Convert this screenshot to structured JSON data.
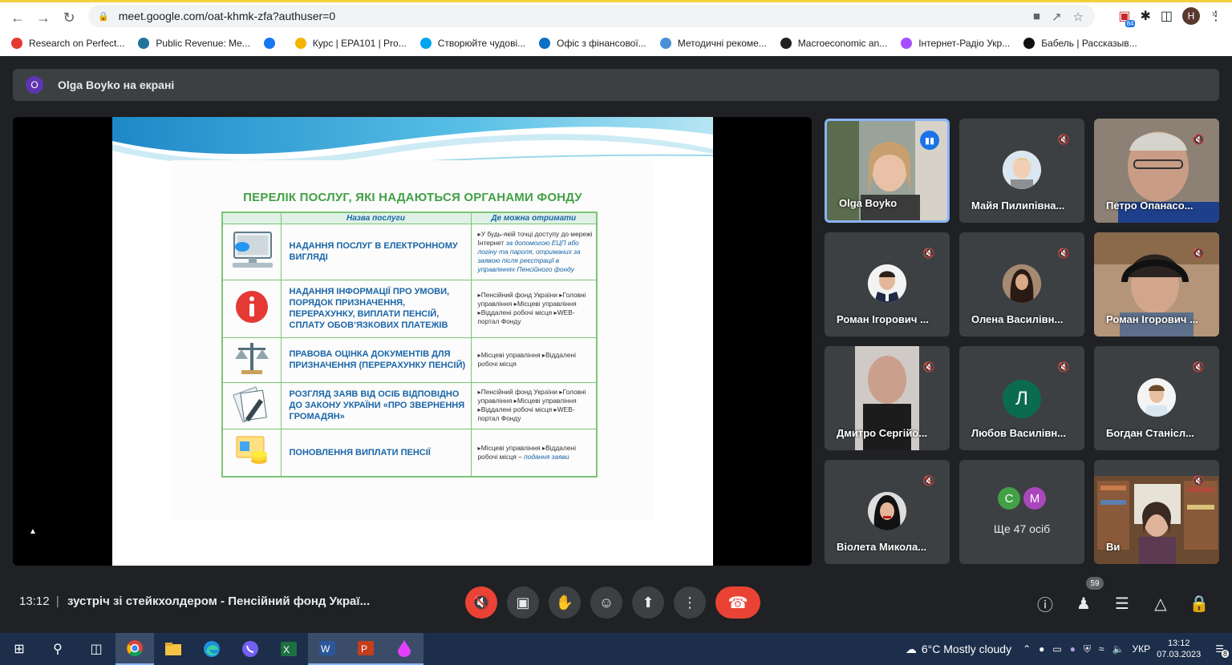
{
  "browser": {
    "url": "meet.google.com/oat-khmk-zfa?authuser=0",
    "profile_initial": "H",
    "ext_badge": "84",
    "bookmarks": [
      {
        "label": "Research on Perfect...",
        "color": "#e53935"
      },
      {
        "label": "Public Revenue: Me...",
        "color": "#21759b"
      },
      {
        "label": "",
        "color": "#1877f2"
      },
      {
        "label": "Курс | EPA101 | Pro...",
        "color": "#f4b400"
      },
      {
        "label": "Створюйте чудові...",
        "color": "#00a4ef"
      },
      {
        "label": "Офіс з фінансової...",
        "color": "#0b6fc4"
      },
      {
        "label": "Методичні рекоме...",
        "color": "#4a90d9"
      },
      {
        "label": "Macroeconomic an...",
        "color": "#222222"
      },
      {
        "label": "Інтернет-Радіо Укр...",
        "color": "#a64dff"
      },
      {
        "label": "Бабель | Рассказыв...",
        "color": "#111111"
      }
    ]
  },
  "meet": {
    "presenting_label": "Olga Boyko на екрані",
    "presenter_initial": "O",
    "slide": {
      "title": "ПЕРЕЛІК ПОСЛУГ, ЯКІ НАДАЮТЬСЯ ОРГАНАМИ ФОНДУ",
      "col_service": "Назва послуги",
      "col_where": "Де можна отримати",
      "rows": [
        {
          "name": "НАДАННЯ ПОСЛУГ В ЕЛЕКТРОННОМУ ВИГЛЯДІ",
          "where_plain": "▸У будь-якій точці доступу до мережі Інтернет",
          "where_italic": "за допомогою ЕЦП або логіну та пароля, отриманих за заявою після реєстрації в управліннях Пенсійного фонду"
        },
        {
          "name": "НАДАННЯ ІНФОРМАЦІЇ ПРО УМОВИ, ПОРЯДОК ПРИЗНАЧЕННЯ, ПЕРЕРАХУНКУ, ВИПЛАТИ ПЕНСІЙ, СПЛАТУ ОБОВ’ЯЗКОВИХ ПЛАТЕЖІВ",
          "where_plain": "▸Пенсійний фонд України ▸Головні управління ▸Місцеві управління ▸Віддалені робочі місця ▸WEB-портал Фонду",
          "where_italic": ""
        },
        {
          "name": "ПРАВОВА ОЦІНКА ДОКУМЕНТІВ ДЛЯ ПРИЗНАЧЕННЯ (ПЕРЕРАХУНКУ ПЕНСІЙ)",
          "where_plain": "▸Місцеві управління ▸Віддалені робочі місця",
          "where_italic": ""
        },
        {
          "name": "РОЗГЛЯД ЗАЯВ ВІД ОСІБ ВІДПОВІДНО ДО ЗАКОНУ УКРАЇНИ «ПРО ЗВЕРНЕННЯ ГРОМАДЯН»",
          "where_plain": "▸Пенсійний фонд України ▸Головні управління ▸Місцеві управління ▸Віддалені робочі місця ▸WEB-портал Фонду",
          "where_italic": ""
        },
        {
          "name": "ПОНОВЛЕННЯ ВИПЛАТИ ПЕНСІЇ",
          "where_plain": "▸Місцеві управління ▸Віддалені робочі місця –",
          "where_italic": "подання заяви"
        }
      ]
    },
    "participants": [
      {
        "name": "Olga Boyko",
        "type": "video",
        "speaking": true
      },
      {
        "name": "Майя Пилипівна...",
        "type": "photo",
        "muted": true
      },
      {
        "name": "Петро Опанасо...",
        "type": "video",
        "muted": true
      },
      {
        "name": "Роман Ігорович ...",
        "type": "photo",
        "muted": true
      },
      {
        "name": "Олена Василівн...",
        "type": "photo",
        "muted": true
      },
      {
        "name": "Роман Ігорович ...",
        "type": "video",
        "muted": true
      },
      {
        "name": "Дмитро Сергійо...",
        "type": "video",
        "muted": true
      },
      {
        "name": "Любов Василівн...",
        "type": "letter",
        "letter": "Л",
        "muted": true
      },
      {
        "name": "Богдан Станісл...",
        "type": "photo",
        "muted": true
      },
      {
        "name": "Віолета Микола...",
        "type": "photo",
        "muted": true
      },
      {
        "name": "Ще 47 осіб",
        "type": "more",
        "letters": [
          "С",
          "М"
        ]
      },
      {
        "name": "Ви",
        "type": "video",
        "muted": true
      }
    ],
    "footer": {
      "time": "13:12",
      "separator": "|",
      "title": "зустріч зі стейкхолдером - Пенсійний фонд Украї...",
      "people_count": "59"
    }
  },
  "taskbar": {
    "weather": "6°C  Mostly cloudy",
    "lang": "УКР",
    "time": "13:12",
    "date": "07.03.2023",
    "notif_count": "8"
  }
}
